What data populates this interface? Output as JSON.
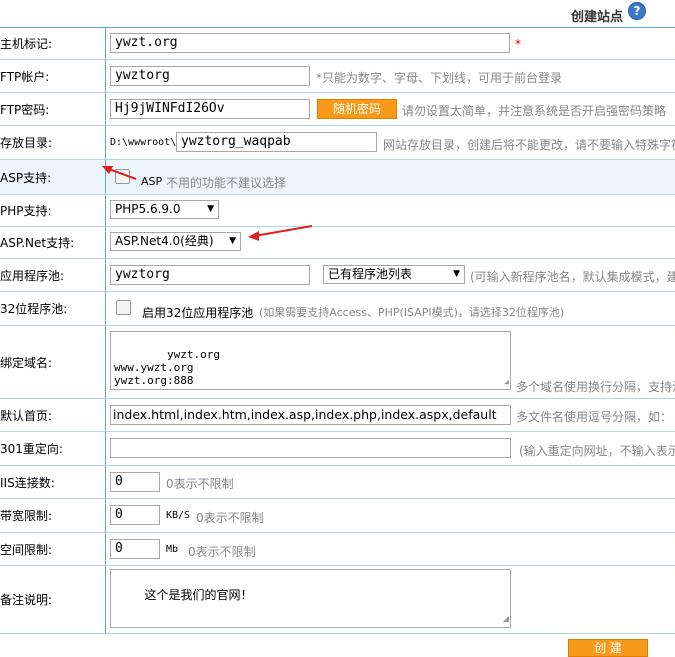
{
  "header": {
    "title": "创建站点",
    "help_icon": "?"
  },
  "fields": {
    "host": {
      "label": "主机标记:",
      "value": "ywzt.org",
      "req": "*"
    },
    "ftp_user": {
      "label": "FTP帐户:",
      "value": "ywztorg",
      "hint": "*只能为数字、字母、下划线，可用于前台登录"
    },
    "ftp_pass": {
      "label": "FTP密码:",
      "value": "Hj9jWINFdI26Ov",
      "button": "随机密码",
      "hint": "请勿设置太简单，并注意系统是否开启强密码策略"
    },
    "dir": {
      "label": "存放目录:",
      "prefix": "D:\\wwwroot\\",
      "value": "ywztorg_waqpab",
      "hint": "网站存放目录，创建后将不能更改，请不要输入特殊字符"
    },
    "asp": {
      "label": "ASP支持:",
      "check_label": "ASP",
      "hint": "不用的功能不建议选择"
    },
    "php": {
      "label": "PHP支持:",
      "selected": "PHP5.6.9.0"
    },
    "aspnet": {
      "label": "ASP.Net支持:",
      "selected": "ASP.Net4.0(经典)"
    },
    "pool": {
      "label": "应用程序池:",
      "value": "ywztorg",
      "selected": "已有程序池列表",
      "hint": "(可输入新程序池名，默认集成模式，建议"
    },
    "pool32": {
      "label": "32位程序池:",
      "check_label": "启用32位应用程序池",
      "hint": "(如果需要支持Access、PHP(ISAPI模式)，请选择32位程序池)"
    },
    "domains": {
      "label": "绑定域名:",
      "value": "ywzt.org\nwww.ywzt.org\nywzt.org:888",
      "hint": "多个域名使用换行分隔，支持泛"
    },
    "index": {
      "label": "默认首页:",
      "value": "index.html,index.htm,index.asp,index.php,index.aspx,default",
      "hint": "多文件名使用逗号分隔，如："
    },
    "redirect": {
      "label": "301重定向:",
      "value": "",
      "hint": "(输入重定向网址，不输入表示"
    },
    "iis": {
      "label": "IIS连接数:",
      "value": "0",
      "hint": "0表示不限制"
    },
    "bandwidth": {
      "label": "带宽限制:",
      "value": "0",
      "unit": "KB/S",
      "hint": "0表示不限制"
    },
    "space": {
      "label": "空间限制:",
      "value": "0",
      "unit": "Mb",
      "hint": "0表示不限制"
    },
    "remark": {
      "label": "备注说明:",
      "value": "这个是我们的官网！"
    }
  },
  "submit": {
    "label": "创 建"
  },
  "colors": {
    "accent": "#f79a1a",
    "border": "#5aa8d8",
    "arrow": "#e0201e",
    "required": "#ee0000"
  }
}
